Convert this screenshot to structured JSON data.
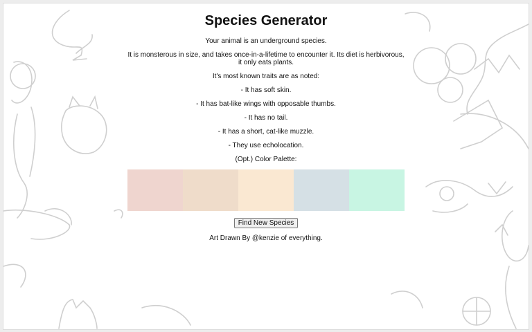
{
  "page": {
    "title": "Species Generator"
  },
  "description": {
    "habitat": "Your animal is an underground species.",
    "size_diet": "It is monsterous in size, and takes once-in-a-lifetime to encounter it. Its diet is herbivorous, it only eats plants.",
    "traits_intro": "It's most known traits are as noted:"
  },
  "traits": [
    "- It has soft skin.",
    "- It has bat-like wings with opposable thumbs.",
    "- It has no tail.",
    "- It has a short, cat-like muzzle.",
    "- They use echolocation."
  ],
  "palette": {
    "label": "(Opt.) Color Palette:",
    "colors": [
      "#efd5cf",
      "#efdcca",
      "#fae8d2",
      "#d5e0e5",
      "#c8f5e3"
    ]
  },
  "actions": {
    "new_species_label": "Find New Species"
  },
  "footer": {
    "credit": "Art Drawn By @kenzie of everything."
  },
  "icons": {
    "background": "sketch-art-background"
  }
}
